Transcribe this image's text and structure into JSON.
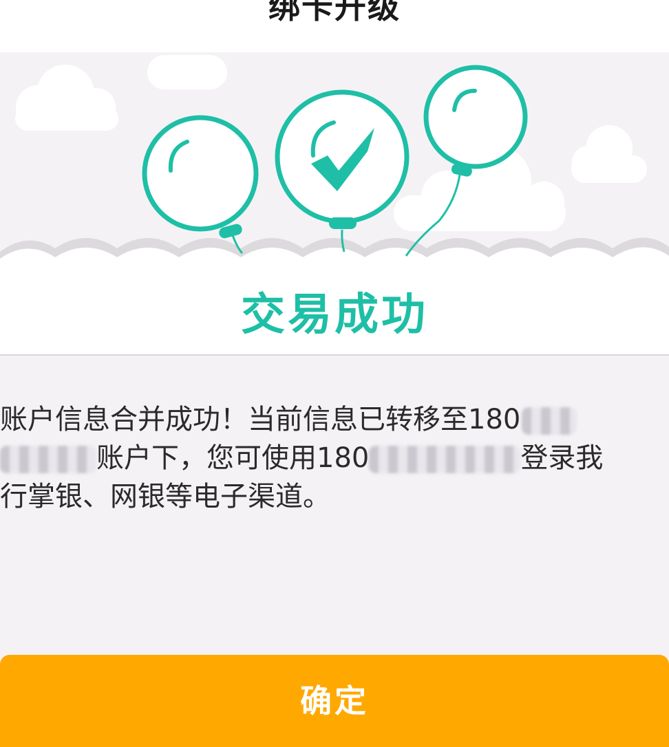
{
  "header": {
    "title": "绑卡升级"
  },
  "result": {
    "status_text": "交易成功"
  },
  "message": {
    "line1": "账户信息合并成功！当前信息已转移至180",
    "line2_a": "账户下，您可使用180",
    "line2_b": "登录我",
    "line3": "行掌银、网银等电子渠道。"
  },
  "actions": {
    "confirm_label": "确定"
  },
  "colors": {
    "accent": "#1ebfa6",
    "button": "#ffa800",
    "background": "#f5f2f6"
  }
}
